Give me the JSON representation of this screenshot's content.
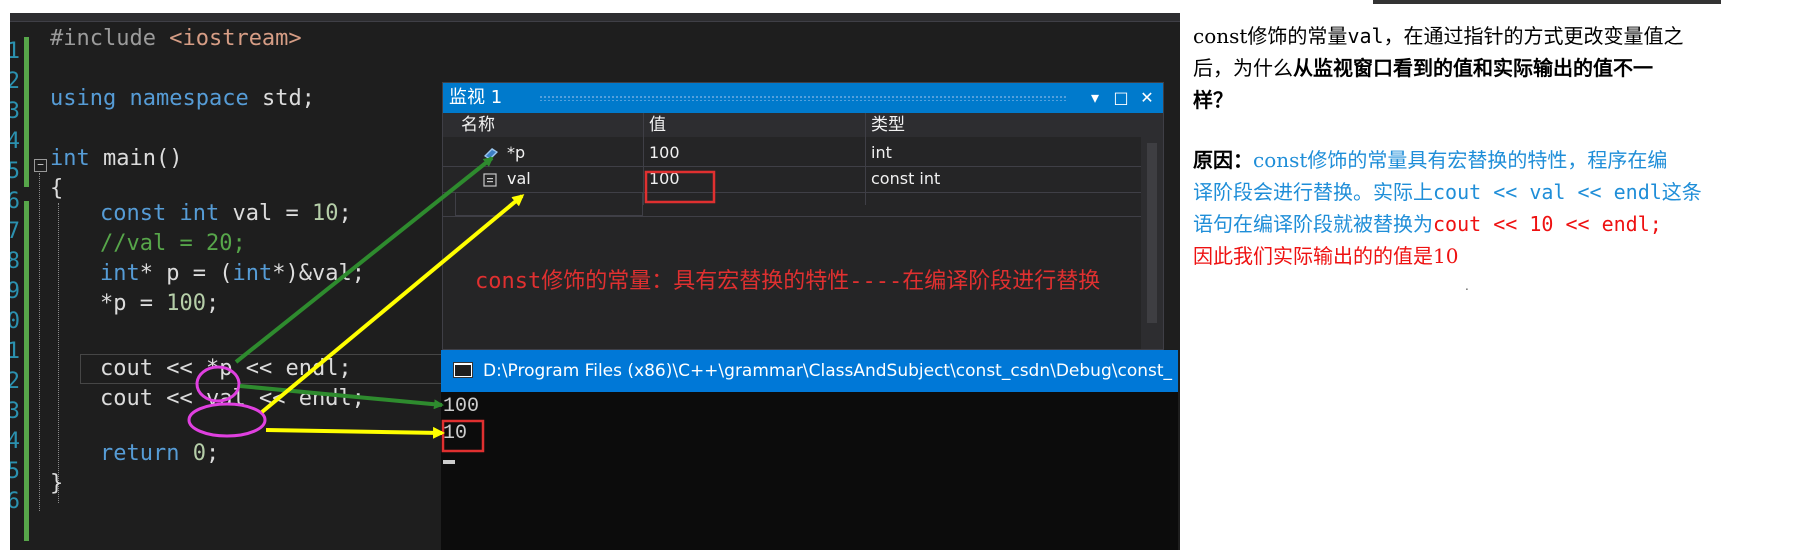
{
  "editor": {
    "line_numbers": [
      "1",
      "2",
      "3",
      "4",
      "5",
      "6",
      "7",
      "8",
      "9",
      "0",
      "1",
      "2",
      "3",
      "4",
      "5",
      "6"
    ],
    "fold_glyph": "−",
    "code": {
      "include_directive": "#include",
      "include_header": "<iostream>",
      "using": "using",
      "namespace_kw": "namespace",
      "std_line": " std;",
      "int_kw": "int",
      "main_sig": " main()",
      "open_brace": "{",
      "const_kw": "const",
      "int_kw2": "int",
      "val_decl": " val = ",
      "val_num": "10",
      "semicolon": ";",
      "comment": "//val = 20;",
      "int_kw3": "int",
      "ptr_decl": "* p = (",
      "int_kw4": "int",
      "ptr_cast": "*)&val;",
      "assign_lhs": "*p = ",
      "assign_num": "100",
      "assign_end": ";",
      "cout1_a": "cout <<",
      "cout1_b": "*p",
      "cout1_c": "<< endl;",
      "cout2_a": "cout <<",
      "cout2_b": "val",
      "cout2_c": "<< endl;",
      "return_kw": "return",
      "return_num": " 0",
      "return_end": ";",
      "close_brace": "}"
    }
  },
  "watch": {
    "title": "监视 1",
    "dropdown_icon": "▾",
    "maximize_icon": "□",
    "close_icon": "✕",
    "columns": [
      "名称",
      "值",
      "类型"
    ],
    "rows": [
      {
        "name": "*p",
        "value": "100",
        "type": "int",
        "icon": "pointer-icon"
      },
      {
        "name": "val",
        "value": "100",
        "type": "const int",
        "icon": "variable-icon"
      },
      {
        "name": "",
        "value": "",
        "type": ""
      }
    ],
    "annotation": "const修饰的常量：具有宏替换的特性----在编译阶段进行替换"
  },
  "console": {
    "title": "D:\\Program Files (x86)\\C++\\grammar\\ClassAndSubject\\const_csdn\\Debug\\const_",
    "lines": [
      "100",
      "10"
    ]
  },
  "explanation": {
    "q1": "const修饰的常量",
    "q2": "val",
    "q3": "，在通过指针的方式更改变量值之",
    "q4": "后，为什么",
    "q5": "从监视窗口看到的值和实际输出的值不一",
    "q6": "样？",
    "reason_label": "原因：",
    "r1": "const修饰的常量具有宏替换的特性，程序在编",
    "r2": "译阶段会进行替换。实际上",
    "r3": "cout << val << endl",
    "r4": "这条",
    "r5": "语句在编译阶段就被替换为",
    "r6": "cout << 10 << endl;",
    "r7": "因此我们实际输出的的值是10",
    "dot": "."
  },
  "colors": {
    "keyword": "#569cd6",
    "string": "#d69d85",
    "comment": "#57a64a",
    "number": "#b5cea8",
    "accent_blue": "#007acc",
    "explain_blue": "#1f8ed8",
    "explain_red": "#ee1111",
    "annotation_circle": "#e040e0",
    "highlight_box": "#e03030",
    "arrow_green": "#2e8b2e",
    "arrow_yellow": "#ffff00"
  }
}
